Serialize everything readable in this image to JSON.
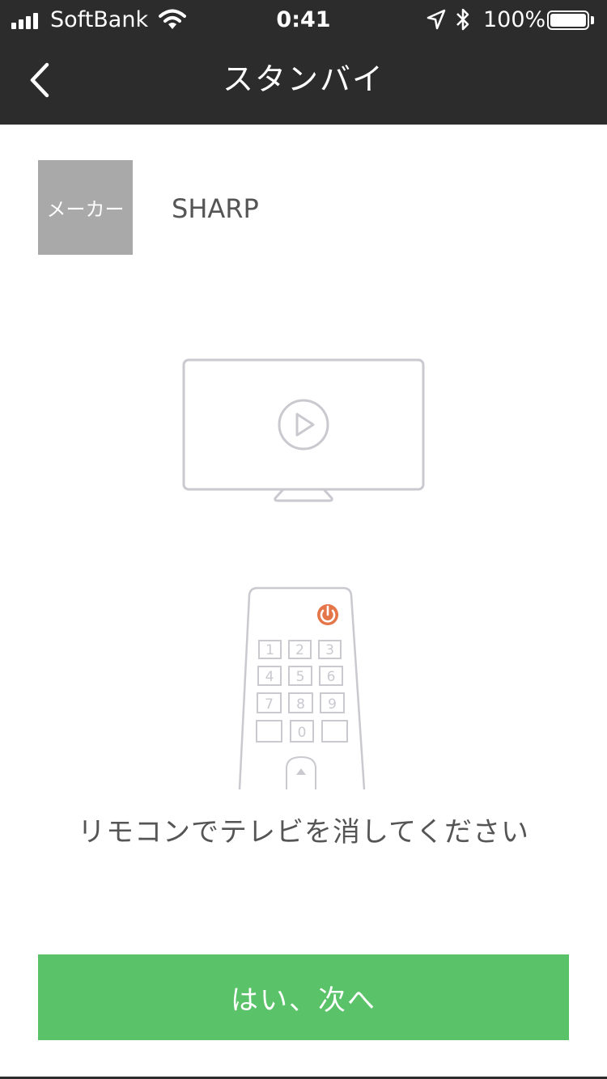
{
  "status_bar": {
    "carrier": "SoftBank",
    "time": "0:41",
    "battery_percent": "100%",
    "battery_level": 1.0,
    "icons": [
      "signal-icon",
      "wifi-icon",
      "location-icon",
      "bluetooth-icon",
      "battery-icon"
    ]
  },
  "nav": {
    "title": "スタンバイ",
    "back_icon": "chevron-left-icon"
  },
  "maker": {
    "label": "メーカー",
    "name": "SHARP"
  },
  "illustration": {
    "tv_icon": "tv-play-icon",
    "remote_keys": [
      "1",
      "2",
      "3",
      "4",
      "5",
      "6",
      "7",
      "8",
      "9",
      "0"
    ],
    "power_color": "#e4764a"
  },
  "instruction": "リモコンでテレビを消してください",
  "next_button": {
    "label": "はい、次へ",
    "color": "#5ac268"
  },
  "colors": {
    "header_bg": "#2c2c2c",
    "tile_bg": "#a9a9a9",
    "illustration_stroke": "#c9c9cf"
  }
}
